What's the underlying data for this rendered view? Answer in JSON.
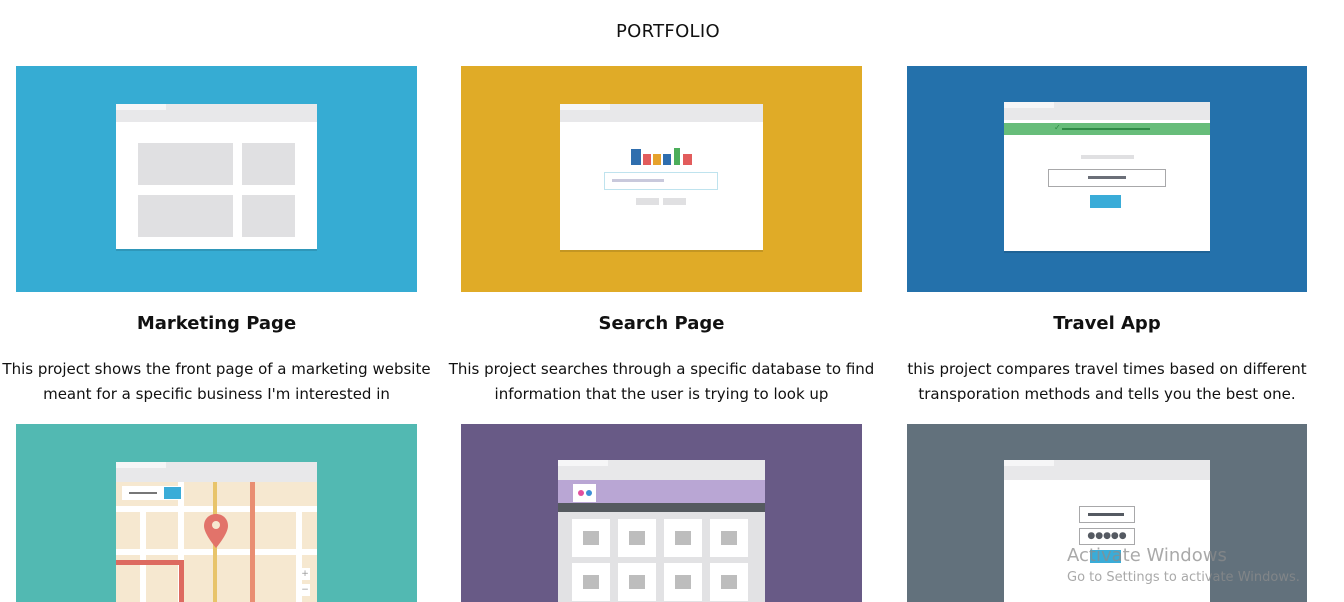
{
  "page": {
    "title": "PORTFOLIO"
  },
  "projects": [
    {
      "title": "Marketing Page",
      "description": "This project shows the front page of a marketing website meant for a specific business I'm interested in",
      "bg_color": "#36acd3",
      "thumbnail": "marketing-layout-icon"
    },
    {
      "title": "Search Page",
      "description": "This project searches through a specific database to find information that the user is trying to look up",
      "bg_color": "#e0ab27",
      "thumbnail": "search-results-icon"
    },
    {
      "title": "Travel App",
      "description": "this project compares travel times based on different transporation methods and tells you the best one.",
      "bg_color": "#2471ab",
      "thumbnail": "travel-form-icon"
    },
    {
      "title": "",
      "description": "",
      "bg_color": "#52b9b2",
      "thumbnail": "map-icon"
    },
    {
      "title": "",
      "description": "",
      "bg_color": "#685a86",
      "thumbnail": "photo-gallery-icon"
    },
    {
      "title": "",
      "description": "",
      "bg_color": "#62717c",
      "thumbnail": "login-form-icon"
    }
  ],
  "watermark": {
    "line1": "Activate Windows",
    "line2": "Go to Settings to activate Windows."
  }
}
